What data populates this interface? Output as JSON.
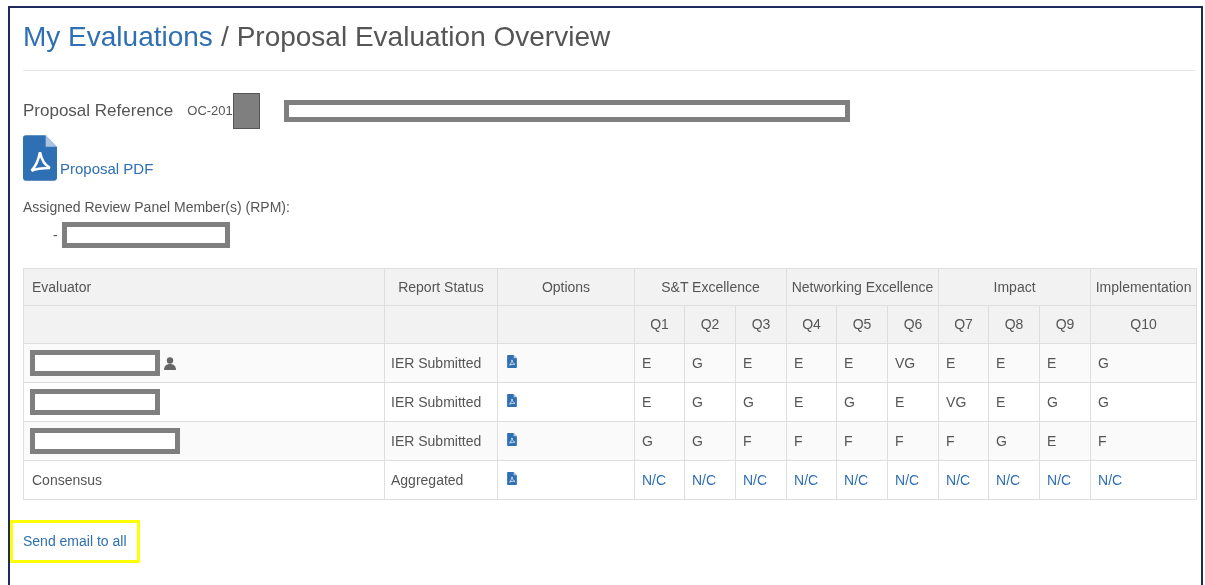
{
  "breadcrumb": {
    "parent": "My Evaluations",
    "separator": "/",
    "current": "Proposal Evaluation Overview"
  },
  "proposal_reference": {
    "label": "Proposal Reference",
    "value": "OC-201",
    "redacted": true
  },
  "proposal_pdf": {
    "label": "Proposal PDF"
  },
  "rpm": {
    "label": "Assigned Review Panel Member(s) (RPM):",
    "members": [
      {
        "bullet": "-",
        "redacted": true
      }
    ]
  },
  "table": {
    "columns": [
      "Evaluator",
      "Report Status",
      "Options"
    ],
    "groups": [
      {
        "label": "S&T Excellence",
        "questions": [
          "Q1",
          "Q2",
          "Q3"
        ]
      },
      {
        "label": "Networking Excellence",
        "questions": [
          "Q4",
          "Q5",
          "Q6"
        ]
      },
      {
        "label": "Impact",
        "questions": [
          "Q7",
          "Q8",
          "Q9"
        ]
      },
      {
        "label": "Implementation",
        "questions": [
          "Q10"
        ]
      }
    ],
    "rows": [
      {
        "redacted": true,
        "is_rpm": true,
        "status": "IER Submitted",
        "scores": [
          "E",
          "G",
          "E",
          "E",
          "E",
          "VG",
          "E",
          "E",
          "E",
          "G"
        ],
        "scores_linked": false
      },
      {
        "redacted": true,
        "is_rpm": false,
        "status": "IER Submitted",
        "scores": [
          "E",
          "G",
          "G",
          "E",
          "G",
          "E",
          "VG",
          "E",
          "G",
          "G"
        ],
        "scores_linked": false
      },
      {
        "redacted": true,
        "is_rpm": false,
        "status": "IER Submitted",
        "scores": [
          "G",
          "G",
          "F",
          "F",
          "F",
          "F",
          "F",
          "G",
          "E",
          "F"
        ],
        "scores_linked": false
      },
      {
        "evaluator": "Consensus",
        "redacted": false,
        "is_rpm": false,
        "status": "Aggregated",
        "scores": [
          "N/C",
          "N/C",
          "N/C",
          "N/C",
          "N/C",
          "N/C",
          "N/C",
          "N/C",
          "N/C",
          "N/C"
        ],
        "scores_linked": true
      }
    ]
  },
  "send_email": {
    "label": "Send email to all",
    "highlighted": true
  }
}
